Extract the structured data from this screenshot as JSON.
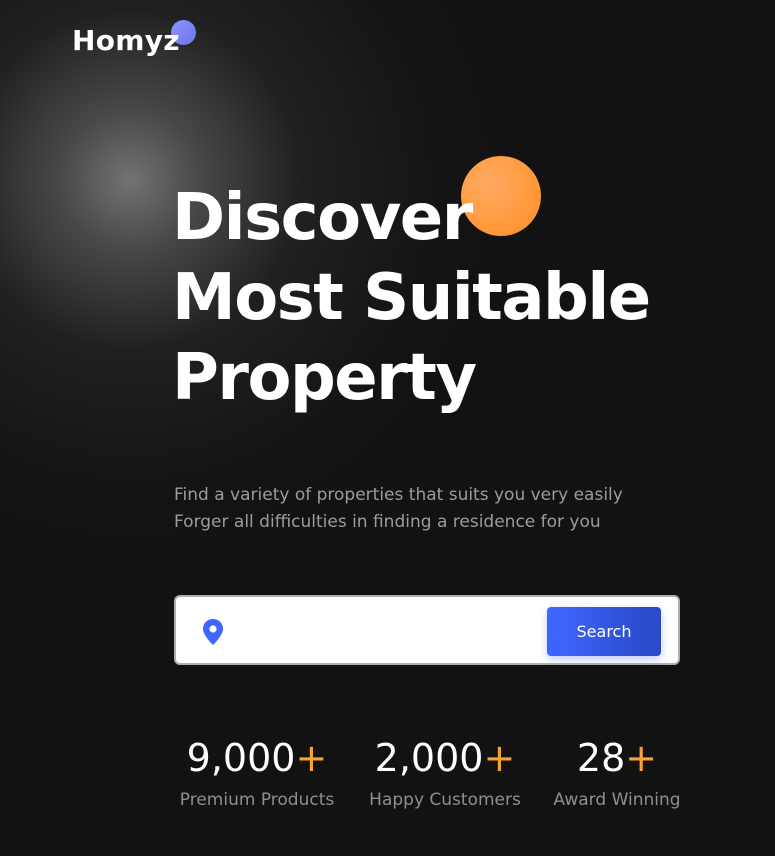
{
  "brand": {
    "logo_text": "Homyz",
    "logo_dot_color": "#8e95ff"
  },
  "hero": {
    "headline_lines": [
      "Discover",
      "Most Suitable",
      "Property"
    ],
    "accent_circle_color": "#ff9a3c",
    "subtext_lines": [
      "Find a variety of properties that suits you very easily",
      "Forger all difficulties in finding a residence for you"
    ]
  },
  "search": {
    "icon": "location-pin-icon",
    "input_value": "",
    "placeholder": "",
    "button_label": "Search",
    "button_color": "#4066ff"
  },
  "stats": [
    {
      "value": "9,000",
      "suffix": "+",
      "label": "Premium Products"
    },
    {
      "value": "2,000",
      "suffix": "+",
      "label": "Happy Customers"
    },
    {
      "value": "28",
      "suffix": "+",
      "label": "Award Winning"
    }
  ],
  "colors": {
    "background": "#131212",
    "accent_orange": "#f7a32c",
    "muted_text": "#8f8f8f"
  }
}
